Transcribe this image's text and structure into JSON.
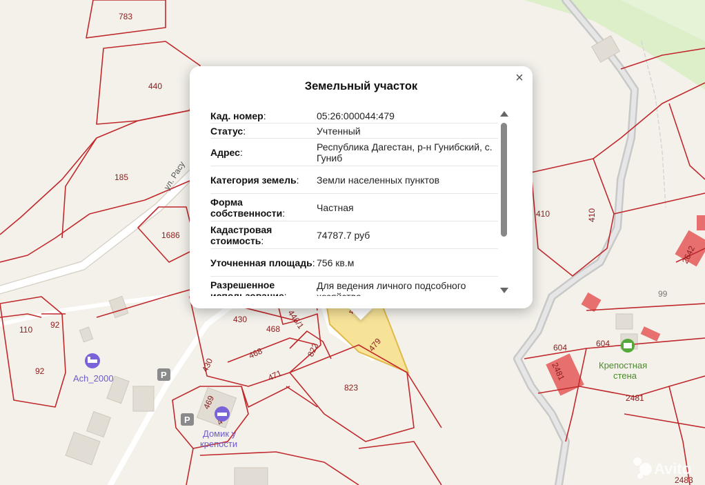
{
  "popup": {
    "title": "Земельный участок",
    "close_symbol": "×",
    "rows": [
      {
        "key": "Кад. номер",
        "value": "05:26:000044:479"
      },
      {
        "key": "Статус",
        "value": "Учтенный"
      },
      {
        "key": "Адрес",
        "value": "Республика Дагестан, р-н Гунибский, с. Гуниб"
      },
      {
        "key": "Категория земель",
        "value": "Земли населенных пунктов"
      },
      {
        "key": "Форма собственности",
        "value": "Частная"
      },
      {
        "key": "Кадастровая стоимость",
        "value": "74787.7 руб"
      },
      {
        "key": "Уточненная площадь",
        "value": "756 кв.м"
      },
      {
        "key": "Разрешенное использование",
        "value": "Для ведения личного подсобного хозяйства"
      }
    ]
  },
  "map": {
    "plot_labels": {
      "p783": "783",
      "p440": "440",
      "p185": "185",
      "p1686": "1686",
      "p410a": "410",
      "p410b": "410",
      "p2642": "2642",
      "p99": "99",
      "p430a": "430",
      "p468a": "468",
      "p446": "446/1",
      "p479": "479",
      "p479b": "47",
      "p822": "822",
      "p468b": "468",
      "p430b": "430",
      "p471": "471",
      "p823": "823",
      "p469": "469",
      "p470": "470",
      "p110": "110",
      "p92a": "92",
      "p92b": "92",
      "p604a": "604",
      "p604b": "604",
      "p2481a": "2481",
      "p2481b": "2481",
      "p2483": "2483"
    },
    "street": "ул. Расу",
    "pois": {
      "hotel": "Ach_2000",
      "guesthouse_line1": "Домик у",
      "guesthouse_line2": "крепости",
      "fortress_line1": "Крепостная",
      "fortress_line2": "стена",
      "parking_a": "P",
      "parking_b": "P"
    },
    "watermark": "Avito",
    "colors": {
      "boundary": "#c0282c",
      "selected_fill": "#f7e08a",
      "selected_stroke": "#e0b94a",
      "hotel_poi": "#7a63d8",
      "fortress_poi": "#55a83a"
    }
  }
}
